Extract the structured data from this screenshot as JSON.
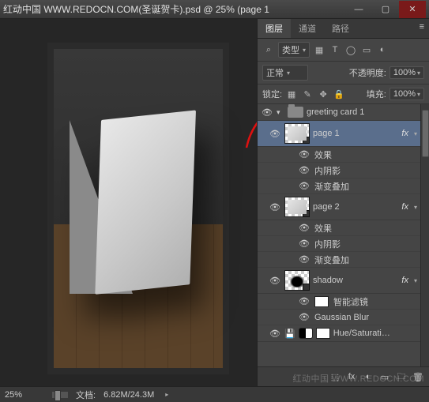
{
  "window": {
    "title": "红动中国 WWW.REDOCN.COM(圣诞贺卡).psd @ 25% (page 1",
    "min": "—",
    "max": "▢",
    "close": "✕"
  },
  "arrow_color": "#d11",
  "panel": {
    "tabs": {
      "layers": "图层",
      "channels": "通道",
      "paths": "路径",
      "menu": "≡"
    },
    "row1": {
      "kind_label": "类型",
      "kind_arrow": "▾",
      "filter_icons": [
        "▦",
        "T",
        "◯",
        "▭",
        "◐"
      ]
    },
    "row2": {
      "blend": "正常",
      "opacity_label": "不透明度:",
      "opacity_value": "100%"
    },
    "row3": {
      "lock_label": "锁定:",
      "lock_icons": [
        "▦",
        "✎",
        "✥",
        "🔒"
      ],
      "fill_label": "填充:",
      "fill_value": "100%"
    },
    "layers": {
      "group": {
        "name": "greeting card 1"
      },
      "page1": {
        "name": "page 1",
        "fx": "fx",
        "effects": "效果",
        "inner_shadow": "内阴影",
        "gradient_overlay": "渐变叠加"
      },
      "page2": {
        "name": "page 2",
        "fx": "fx",
        "effects": "效果",
        "inner_shadow": "内阴影",
        "gradient_overlay": "渐变叠加"
      },
      "shadow": {
        "name": "shadow",
        "fx": "fx",
        "smart_filters": "智能滤镜",
        "gblur": "Gaussian Blur"
      },
      "huesat": {
        "name": "Hue/Saturati…"
      }
    },
    "bottom_icons": [
      "⬚",
      "fx",
      "◐",
      "▭",
      "🗀",
      "🗑"
    ]
  },
  "status": {
    "zoom": "25%",
    "doc_label": "文档:",
    "doc_value": "6.82M/24.3M"
  },
  "watermark": "红动中国 WWW.REDOCN.COM"
}
